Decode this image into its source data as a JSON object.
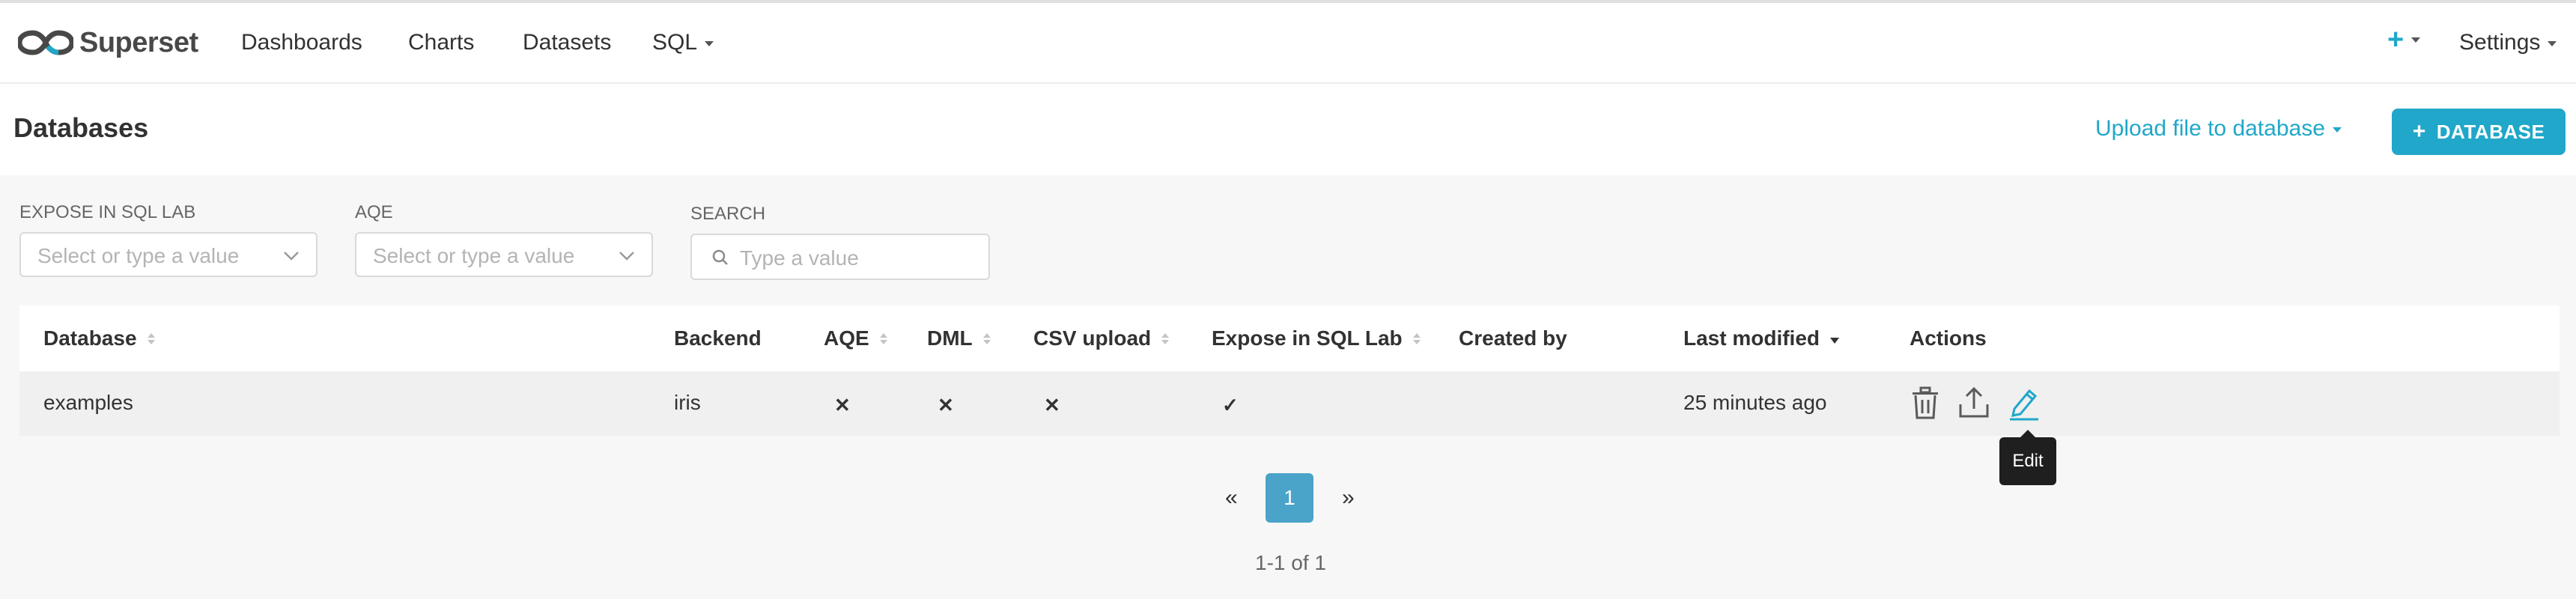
{
  "nav": {
    "brand": "Superset",
    "items": [
      {
        "label": "Dashboards"
      },
      {
        "label": "Charts"
      },
      {
        "label": "Datasets"
      },
      {
        "label": "SQL"
      }
    ],
    "plus_icon": "plus-icon",
    "settings_label": "Settings"
  },
  "header": {
    "title": "Databases",
    "upload_label": "Upload file to database",
    "add_button_label": "DATABASE"
  },
  "filters": {
    "expose": {
      "label": "EXPOSE IN SQL LAB",
      "placeholder": "Select or type a value"
    },
    "aqe": {
      "label": "AQE",
      "placeholder": "Select or type a value"
    },
    "search": {
      "label": "SEARCH",
      "placeholder": "Type a value"
    }
  },
  "table": {
    "columns": [
      {
        "label": "Database",
        "sort": "both"
      },
      {
        "label": "Backend",
        "sort": "none"
      },
      {
        "label": "AQE",
        "sort": "both"
      },
      {
        "label": "DML",
        "sort": "both"
      },
      {
        "label": "CSV upload",
        "sort": "both"
      },
      {
        "label": "Expose in SQL Lab",
        "sort": "both"
      },
      {
        "label": "Created by",
        "sort": "none"
      },
      {
        "label": "Last modified",
        "sort": "desc"
      },
      {
        "label": "Actions",
        "sort": "none"
      }
    ],
    "rows": [
      {
        "database": "examples",
        "backend": "iris",
        "aqe": "✕",
        "dml": "✕",
        "csv_upload": "✕",
        "expose": "✓",
        "created_by": "",
        "last_modified": "25 minutes ago",
        "actions": [
          "trash-icon",
          "export-icon",
          "edit-icon"
        ]
      }
    ]
  },
  "tooltip": {
    "text": "Edit"
  },
  "pagination": {
    "prev": "«",
    "current": "1",
    "next": "»",
    "summary": "1-1 of 1"
  },
  "colors": {
    "accent": "#20a7c9",
    "page_active": "#4aa3c8",
    "tooltip_bg": "#1f1f1f"
  }
}
